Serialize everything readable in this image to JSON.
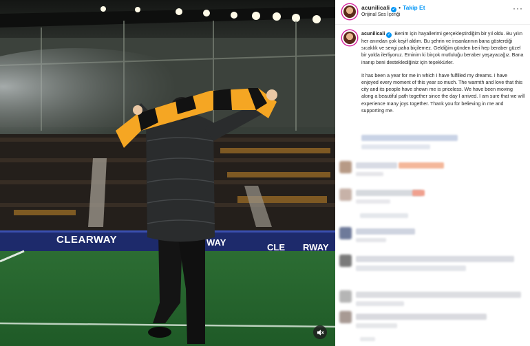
{
  "post": {
    "username": "acunilicali",
    "follow_label": "Takip Et",
    "separator": "•",
    "audio_label": "Orijinal Ses İçeriği",
    "more_icon": "more-horizontal-icon",
    "caption_tr": "Benim için hayallerimi gerçekleştirdiğim bir yıl oldu. Bu yılın her anından çok keyif aldım. Bu şehrin ve insanlarının bana gösterdiği sıcaklık ve sevgi paha biçilemez. Geldiğim günden beri hep beraber güzel bir yolda ilerliyoruz. Eminim ki birçok mutluluğu beraber yaşayacağız. Bana inanıp beni desteklediğiniz için teşekkürler.",
    "caption_en": "It has been a year for me in which I have fulfilled my dreams. I have enjoyed every moment of this year so much. The warmth and love that this city and its people have shown me is priceless. We have been moving along a beautiful path together since the day I arrived. I am sure that we will experience many joys together. Thank you for believing in me and supporting me."
  },
  "media": {
    "banner_texts": [
      "CLEARWAY",
      "WAY",
      "CLE",
      "RWAY"
    ],
    "mute_icon": "speaker-muted-icon"
  },
  "colors": {
    "accent": "#0095f6",
    "scarf_orange": "#f5a623",
    "banner_blue": "#1d2a6b",
    "pitch_green": "#2e7d32"
  }
}
